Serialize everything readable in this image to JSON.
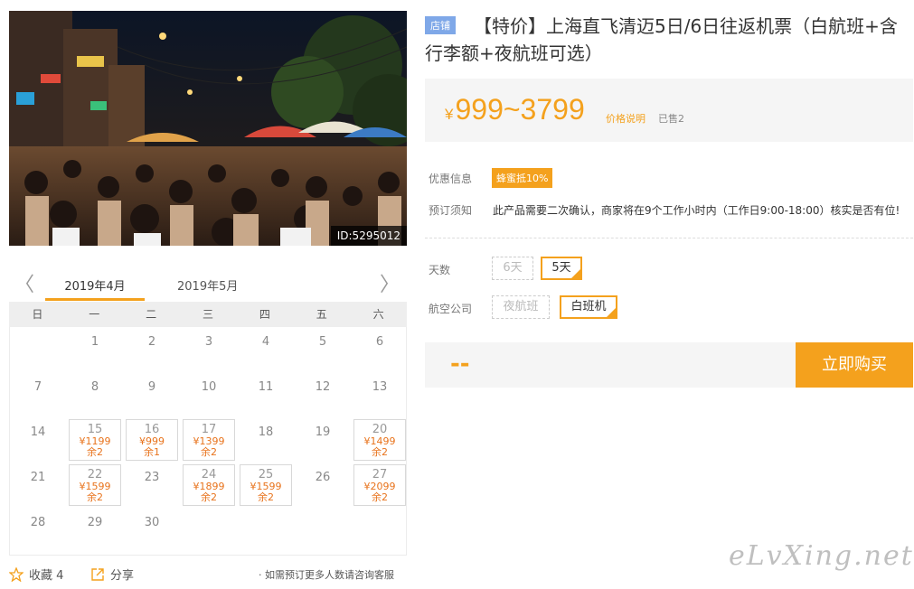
{
  "photo": {
    "id_label": "ID:5295012"
  },
  "calendar": {
    "prev_arrow": "〈",
    "next_arrow": "〉",
    "active_month": "2019年4月",
    "next_month": "2019年5月",
    "weekdays": [
      "日",
      "一",
      "二",
      "三",
      "四",
      "五",
      "六"
    ],
    "rows": [
      [
        {
          "d": ""
        },
        {
          "d": "1"
        },
        {
          "d": "2"
        },
        {
          "d": "3"
        },
        {
          "d": "4"
        },
        {
          "d": "5"
        },
        {
          "d": "6"
        }
      ],
      [
        {
          "d": "7"
        },
        {
          "d": "8"
        },
        {
          "d": "9"
        },
        {
          "d": "10"
        },
        {
          "d": "11"
        },
        {
          "d": "12"
        },
        {
          "d": "13"
        }
      ],
      [
        {
          "d": "14"
        },
        {
          "d": "15",
          "p": "¥1199",
          "r": "余2"
        },
        {
          "d": "16",
          "p": "¥999",
          "r": "余1"
        },
        {
          "d": "17",
          "p": "¥1399",
          "r": "余2"
        },
        {
          "d": "18"
        },
        {
          "d": "19"
        },
        {
          "d": "20",
          "p": "¥1499",
          "r": "余2"
        }
      ],
      [
        {
          "d": "21"
        },
        {
          "d": "22",
          "p": "¥1599",
          "r": "余2"
        },
        {
          "d": "23"
        },
        {
          "d": "24",
          "p": "¥1899",
          "r": "余2"
        },
        {
          "d": "25",
          "p": "¥1599",
          "r": "余2"
        },
        {
          "d": "26"
        },
        {
          "d": "27",
          "p": "¥2099",
          "r": "余2"
        }
      ],
      [
        {
          "d": "28"
        },
        {
          "d": "29"
        },
        {
          "d": "30"
        },
        {
          "d": ""
        },
        {
          "d": ""
        },
        {
          "d": ""
        },
        {
          "d": ""
        }
      ]
    ]
  },
  "actions": {
    "favorite_label": "收藏 4",
    "share_label": "分享",
    "note": "· 如需预订更多人数请咨询客服"
  },
  "product": {
    "shop_badge": "店铺",
    "title": "【特价】上海直飞清迈5日/6日往返机票（白航班+含行李额+夜航班可选）",
    "price_currency": "¥",
    "price_range": "999~3799",
    "price_explain": "价格说明",
    "sold": "已售2",
    "promo_label": "优惠信息",
    "promo_tag": "蜂蜜抵10%",
    "notice_label": "预订须知",
    "notice_text": "此产品需要二次确认，商家将在9个工作小时内（工作日9:00-18:00）核实是否有位!",
    "days_label": "天数",
    "days_options": [
      "6天",
      "5天"
    ],
    "airline_label": "航空公司",
    "airline_options": [
      "夜航班",
      "白班机"
    ],
    "total_placeholder": "--",
    "buy_button": "立即购买"
  },
  "watermark": "eLvXing.net",
  "colors": {
    "accent": "#f4a11d",
    "badge": "#7fa8e8",
    "price_text": "#e8731c"
  }
}
